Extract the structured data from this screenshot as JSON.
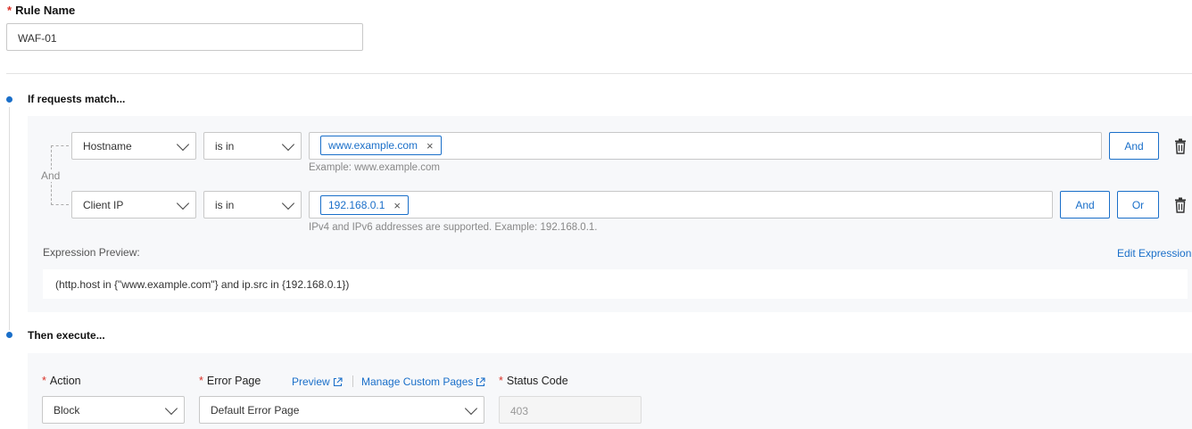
{
  "rule_name": {
    "label": "Rule Name",
    "value": "WAF-01"
  },
  "match_section": {
    "title": "If requests match..."
  },
  "conditions": [
    {
      "field": "Hostname",
      "operator": "is in",
      "tag": "www.example.com",
      "hint": "Example: www.example.com",
      "and_label": "And"
    },
    {
      "field": "Client IP",
      "operator": "is in",
      "tag": "192.168.0.1",
      "hint": "IPv4 and IPv6 addresses are supported. Example: 192.168.0.1.",
      "and_label": "And",
      "or_label": "Or"
    }
  ],
  "connector_label": "And",
  "expression": {
    "label": "Expression Preview:",
    "edit_label": "Edit Expression",
    "value": "(http.host in {\"www.example.com\"} and ip.src in {192.168.0.1})"
  },
  "execute_section": {
    "title": "Then execute..."
  },
  "action": {
    "label": "Action",
    "value": "Block"
  },
  "error_page": {
    "label": "Error Page",
    "value": "Default Error Page",
    "preview_label": "Preview",
    "manage_label": "Manage Custom Pages"
  },
  "status_code": {
    "label": "Status Code",
    "value": "403"
  },
  "colors": {
    "accent": "#1a6fc9",
    "required": "#d93026"
  },
  "icons": [
    "chevron-down-icon",
    "close-icon",
    "trash-icon",
    "external-link-icon"
  ]
}
